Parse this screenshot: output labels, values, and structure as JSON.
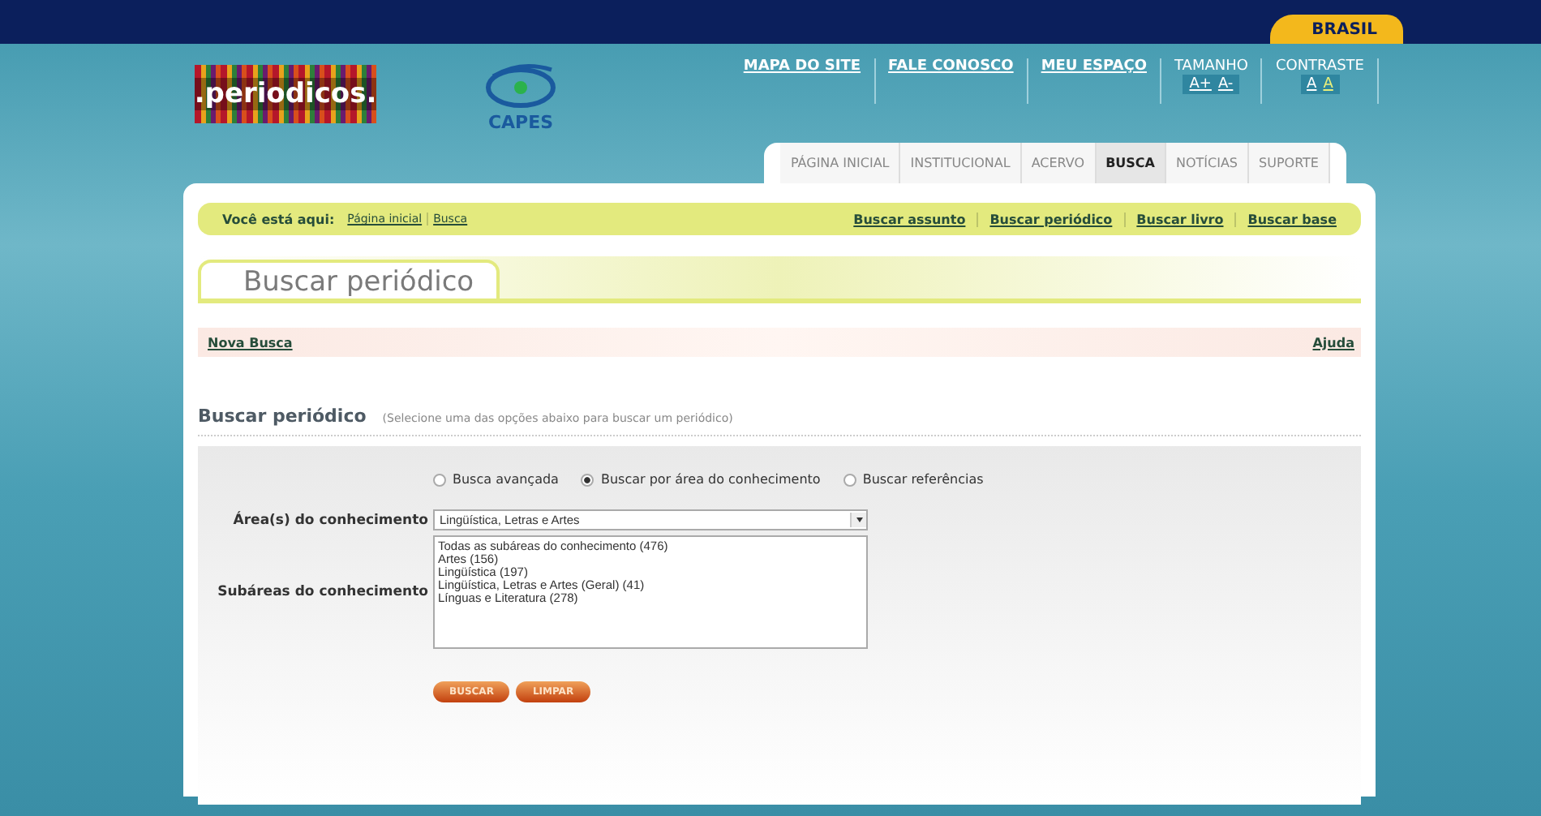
{
  "gov_bar": {
    "label": "BRASIL"
  },
  "logo": {
    "text": ".periodicos.",
    "partner": "CAPES"
  },
  "top_links": [
    "MAPA DO SITE",
    "FALE CONOSCO",
    "MEU ESPAÇO"
  ],
  "size_control": {
    "label": "TAMANHO",
    "options": [
      "A+",
      "A-"
    ]
  },
  "contrast_control": {
    "label": "CONTRASTE",
    "options": [
      {
        "label": "A",
        "selected": true
      },
      {
        "label": "A",
        "selected": false
      }
    ]
  },
  "tabs": [
    {
      "label": "PÁGINA INICIAL",
      "selected": false
    },
    {
      "label": "INSTITUCIONAL",
      "selected": false
    },
    {
      "label": "ACERVO",
      "selected": false
    },
    {
      "label": "BUSCA",
      "selected": true
    },
    {
      "label": "NOTÍCIAS",
      "selected": false
    },
    {
      "label": "SUPORTE",
      "selected": false
    }
  ],
  "breadcrumb": {
    "label": "Você está aqui:",
    "items": [
      "Página inicial",
      "Busca"
    ]
  },
  "search_links": [
    "Buscar assunto",
    "Buscar periódico",
    "Buscar livro",
    "Buscar base"
  ],
  "page_title": "Buscar periódico",
  "action_bar": {
    "left": "Nova Busca",
    "right": "Ajuda"
  },
  "section": {
    "title": "Buscar periódico",
    "hint": "(Selecione uma das opções abaixo para buscar um periódico)"
  },
  "search_modes": [
    {
      "label": "Busca avançada",
      "selected": false
    },
    {
      "label": "Buscar por área do conhecimento",
      "selected": true
    },
    {
      "label": "Buscar referências",
      "selected": false
    }
  ],
  "area_field": {
    "label": "Área(s) do conhecimento",
    "value": "Lingüística, Letras e Artes"
  },
  "subarea_field": {
    "label": "Subáreas do conhecimento",
    "options": [
      "Todas as subáreas do conhecimento (476)",
      "Artes (156)",
      "Lingüística (197)",
      "Lingüística, Letras e Artes (Geral) (41)",
      "Línguas e Literatura (278)"
    ]
  },
  "buttons": [
    "BUSCAR",
    "LIMPAR"
  ]
}
